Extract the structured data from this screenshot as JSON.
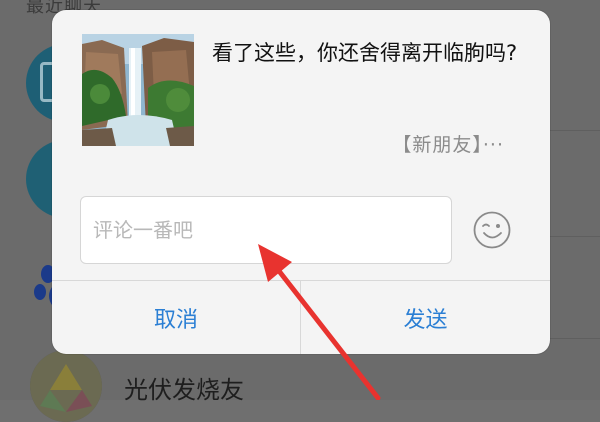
{
  "background": {
    "section_title": "最近聊天",
    "contact_name": "光伏发烧友"
  },
  "dialog": {
    "share_title": "看了这些，你还舍得离开临朐吗?",
    "share_source": "【新朋友】···",
    "comment": {
      "placeholder": "评论一番吧",
      "value": ""
    },
    "emoji_icon": "smiley-icon",
    "cancel_label": "取消",
    "send_label": "发送"
  },
  "colors": {
    "accent": "#2b7fd4",
    "annotation": "#e8332f"
  }
}
